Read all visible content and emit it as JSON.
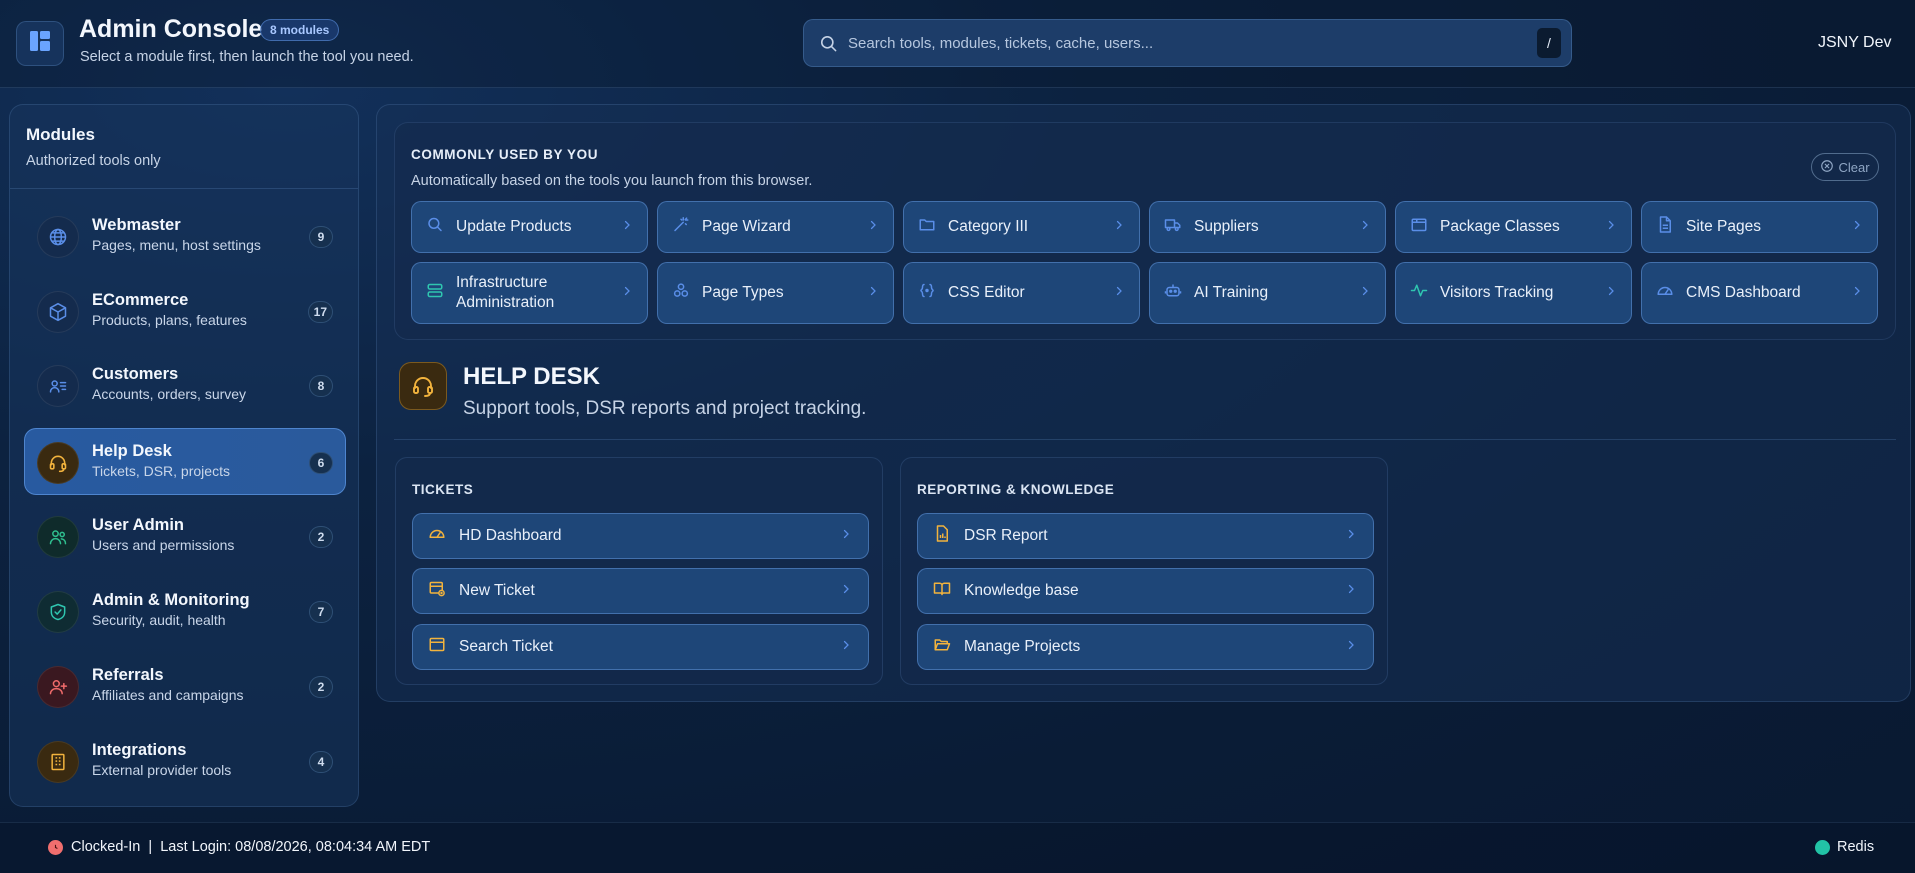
{
  "header": {
    "title": "Admin Console",
    "modules_badge": "8 modules",
    "subtitle": "Select a module first, then launch the tool you need.",
    "search_placeholder": "Search tools, modules, tickets, cache, users...",
    "search_shortcut": "/",
    "user": "JSNY Dev"
  },
  "sidebar": {
    "title": "Modules",
    "subtitle": "Authorized tools only",
    "items": [
      {
        "name": "Webmaster",
        "desc": "Pages, menu, host settings",
        "count": "9",
        "icon": "globe-icon",
        "color": "#5a8ee8",
        "active": false
      },
      {
        "name": "ECommerce",
        "desc": "Products, plans, features",
        "count": "17",
        "icon": "cube-icon",
        "color": "#5a8ee8",
        "active": false
      },
      {
        "name": "Customers",
        "desc": "Accounts, orders, survey",
        "count": "8",
        "icon": "contacts-icon",
        "color": "#5a8ee8",
        "active": false
      },
      {
        "name": "Help Desk",
        "desc": "Tickets, DSR, projects",
        "count": "6",
        "icon": "headset-icon",
        "color": "#f2b33d",
        "active": true
      },
      {
        "name": "User Admin",
        "desc": "Users and permissions",
        "count": "2",
        "icon": "users-icon",
        "color": "#2fbf8f",
        "active": false
      },
      {
        "name": "Admin & Monitoring",
        "desc": "Security, audit, health",
        "count": "7",
        "icon": "shield-check-icon",
        "color": "#2fc6b0",
        "active": false
      },
      {
        "name": "Referrals",
        "desc": "Affiliates and campaigns",
        "count": "2",
        "icon": "user-plus-icon",
        "color": "#ef6b6b",
        "active": false
      },
      {
        "name": "Integrations",
        "desc": "External provider tools",
        "count": "4",
        "icon": "building-icon",
        "color": "#f2b33d",
        "active": false
      }
    ]
  },
  "recent": {
    "title": "COMMONLY USED BY YOU",
    "subtitle": "Automatically based on the tools you launch from this browser.",
    "clear_label": "Clear",
    "tools": [
      {
        "label": "Update Products",
        "icon": "search-icon"
      },
      {
        "label": "Page Wizard",
        "icon": "wand-icon"
      },
      {
        "label": "Category III",
        "icon": "folder-icon"
      },
      {
        "label": "Suppliers",
        "icon": "truck-icon"
      },
      {
        "label": "Package Classes",
        "icon": "package-icon"
      },
      {
        "label": "Site Pages",
        "icon": "file-icon"
      },
      {
        "label": "Infrastructure Administration",
        "icon": "server-icon"
      },
      {
        "label": "Page Types",
        "icon": "shapes-icon"
      },
      {
        "label": "CSS Editor",
        "icon": "code-braces-icon"
      },
      {
        "label": "AI Training",
        "icon": "robot-icon"
      },
      {
        "label": "Visitors Tracking",
        "icon": "activity-icon"
      },
      {
        "label": "CMS Dashboard",
        "icon": "gauge-icon"
      }
    ]
  },
  "module": {
    "title": "HELP DESK",
    "subtitle": "Support tools, DSR reports and project tracking.",
    "icon": "headset-icon",
    "groups": [
      {
        "title": "TICKETS",
        "items": [
          {
            "label": "HD Dashboard",
            "icon": "gauge-icon"
          },
          {
            "label": "New Ticket",
            "icon": "ticket-plus-icon"
          },
          {
            "label": "Search Ticket",
            "icon": "window-icon"
          }
        ]
      },
      {
        "title": "REPORTING & KNOWLEDGE",
        "items": [
          {
            "label": "DSR Report",
            "icon": "report-icon"
          },
          {
            "label": "Knowledge base",
            "icon": "book-icon"
          },
          {
            "label": "Manage Projects",
            "icon": "folder-open-icon"
          }
        ]
      }
    ]
  },
  "footer": {
    "status": "Clocked-In  |  Last Login: 08/08/2026, 08:04:34 AM EDT",
    "cache_label": "Redis"
  },
  "colors": {
    "accent_blue": "#5a8ee8",
    "helpdesk_amber": "#f2b33d",
    "status_red": "#f06e6e",
    "status_green": "#22c3a6"
  }
}
